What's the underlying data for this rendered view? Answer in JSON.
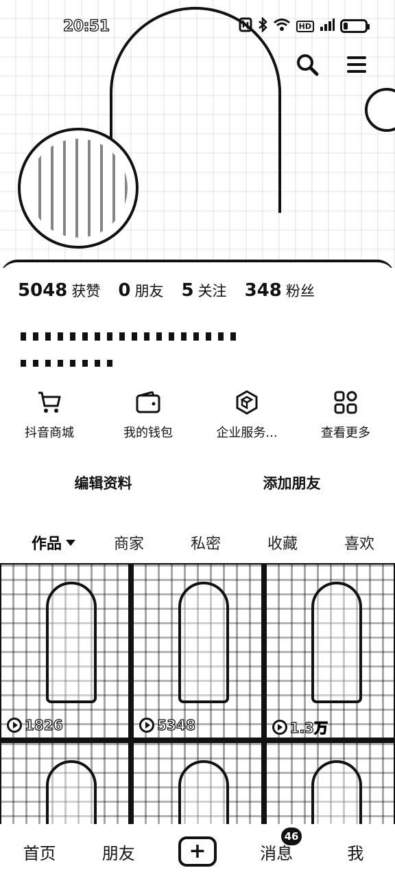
{
  "status_bar": {
    "time": "20:51",
    "hd_label": "HD"
  },
  "stats": [
    {
      "number": "5048",
      "label": "获赞"
    },
    {
      "number": "0",
      "label": "朋友"
    },
    {
      "number": "5",
      "label": "关注"
    },
    {
      "number": "348",
      "label": "粉丝"
    }
  ],
  "shortcuts": [
    {
      "label": "抖音商城",
      "icon": "cart-icon"
    },
    {
      "label": "我的钱包",
      "icon": "wallet-icon"
    },
    {
      "label": "企业服务...",
      "icon": "enterprise-icon"
    },
    {
      "label": "查看更多",
      "icon": "more-grid-icon"
    }
  ],
  "profile_actions": {
    "edit_label": "编辑资料",
    "add_friend_label": "添加朋友"
  },
  "tabs": [
    {
      "label": "作品",
      "active": true
    },
    {
      "label": "商家",
      "active": false
    },
    {
      "label": "私密",
      "active": false
    },
    {
      "label": "收藏",
      "active": false
    },
    {
      "label": "喜欢",
      "active": false
    }
  ],
  "videos": [
    {
      "plays": "1826"
    },
    {
      "plays": "5348"
    },
    {
      "plays": "1.3万"
    },
    {
      "plays": ""
    },
    {
      "plays": ""
    },
    {
      "plays": ""
    }
  ],
  "bottom_nav": {
    "home": "首页",
    "friends": "朋友",
    "plus": "+",
    "messages": "消息",
    "messages_badge": "46",
    "me": "我"
  }
}
